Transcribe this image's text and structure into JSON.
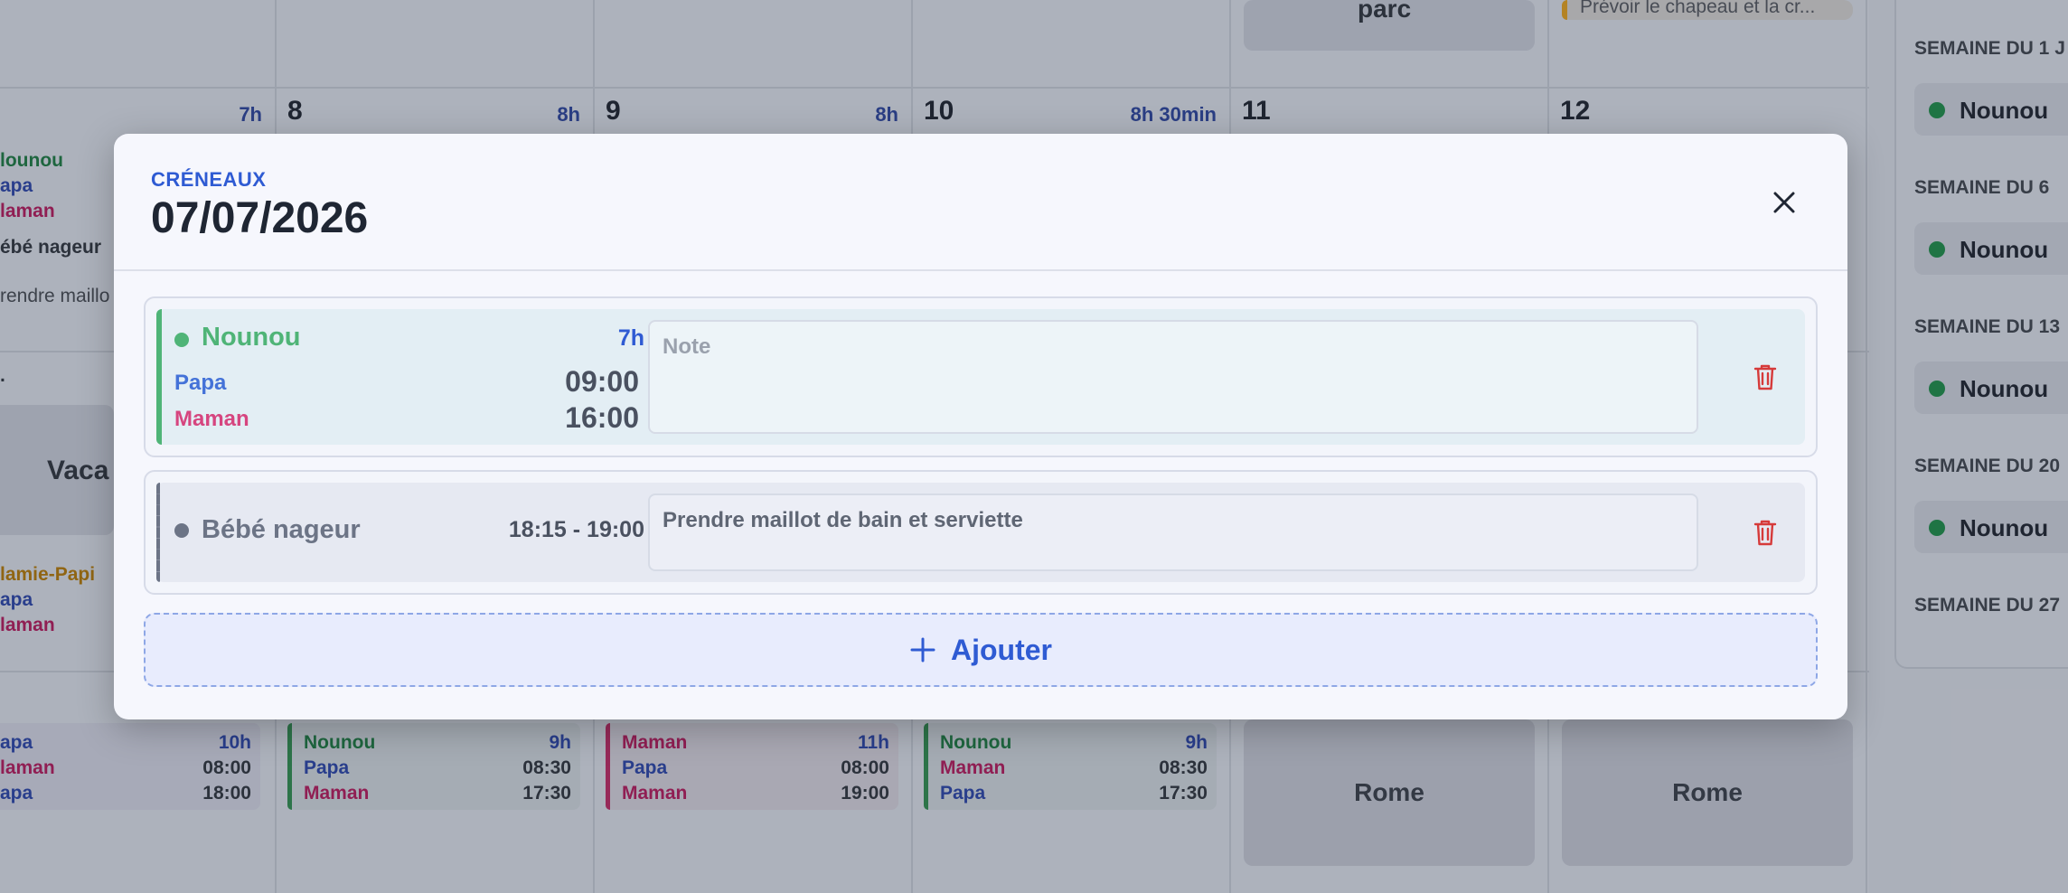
{
  "background": {
    "days": [
      {
        "num": "8",
        "hours": "8h"
      },
      {
        "num": "9",
        "hours": "8h"
      },
      {
        "num": "10",
        "hours": "8h 30min"
      },
      {
        "num": "11",
        "hours": ""
      },
      {
        "num": "12",
        "hours": ""
      }
    ],
    "prev_day_hours": "7h",
    "top_card_text": "parc",
    "top_note_text": "Prévoir le chapeau et la cr...",
    "left_slot_mid": {
      "lines": [
        "lounou",
        "apa",
        "laman"
      ]
    },
    "left_event": "ébé nageur",
    "left_note": "rendre maillo",
    "left_vaca": "Vaca",
    "left_dot": ".",
    "left_slot_mamie": {
      "lines": [
        "lamie-Papi",
        "apa",
        "laman"
      ]
    },
    "bottom_slots": [
      {
        "lines": [
          "apa",
          "laman",
          "apa"
        ],
        "right": [
          "10h",
          "08:00",
          "18:00"
        ]
      },
      {
        "lines": [
          "Nounou",
          "Papa",
          "Maman"
        ],
        "right": [
          "9h",
          "08:30",
          "17:30"
        ]
      },
      {
        "lines": [
          "Maman",
          "Papa",
          "Maman"
        ],
        "right": [
          "11h",
          "08:00",
          "19:00"
        ]
      },
      {
        "lines": [
          "Nounou",
          "Maman",
          "Papa"
        ],
        "right": [
          "9h",
          "08:30",
          "17:30"
        ]
      }
    ],
    "rome": [
      "Rome",
      "Rome"
    ],
    "sidebar": {
      "weeks": [
        "SEMAINE DU 1 J",
        "SEMAINE DU 6",
        "SEMAINE DU 13",
        "SEMAINE DU 20",
        "SEMAINE DU 27"
      ],
      "pill_label": "Nounou"
    }
  },
  "modal": {
    "eyebrow": "CRÉNEAUX",
    "title": "07/07/2026",
    "slots": [
      {
        "name": "Nounou",
        "duration": "7h",
        "drop_off_person": "Papa",
        "pick_up_person": "Maman",
        "start": "09:00",
        "end": "16:00",
        "note_value": "",
        "note_placeholder": "Note"
      },
      {
        "name": "Bébé nageur",
        "range": "18:15 - 19:00",
        "note_value": "Prendre maillot de bain et serviette",
        "note_placeholder": "Note"
      }
    ],
    "add_label": "Ajouter"
  },
  "colors": {
    "accent_blue": "#2f5bd3",
    "nounou_green": "#4fb477",
    "papa_blue": "#4472d8",
    "maman_pink": "#d6457f",
    "trash_red": "#d63a3a"
  }
}
